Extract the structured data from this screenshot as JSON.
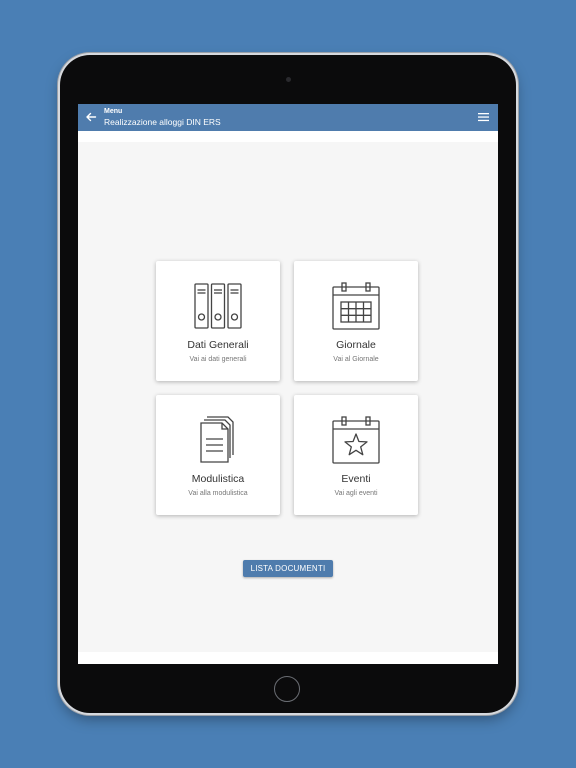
{
  "app_bar": {
    "title": "Menu",
    "subtitle": "Realizzazione alloggi DIN ERS",
    "back_icon": "arrow-left-icon",
    "menu_icon": "hamburger-menu-icon",
    "color": "#4f7cad"
  },
  "cards": [
    {
      "title": "Dati Generali",
      "subtitle": "Vai ai dati generali",
      "icon": "binders-icon"
    },
    {
      "title": "Giornale",
      "subtitle": "Vai al Giornale",
      "icon": "calendar-icon"
    },
    {
      "title": "Modulistica",
      "subtitle": "Vai alla modulistica",
      "icon": "documents-icon"
    },
    {
      "title": "Eventi",
      "subtitle": "Vai agli eventi",
      "icon": "calendar-star-icon"
    }
  ],
  "documents_button": {
    "label": "LISTA DOCUMENTI"
  },
  "colors": {
    "accent": "#4f7cad",
    "background": "#4a7fb5"
  }
}
